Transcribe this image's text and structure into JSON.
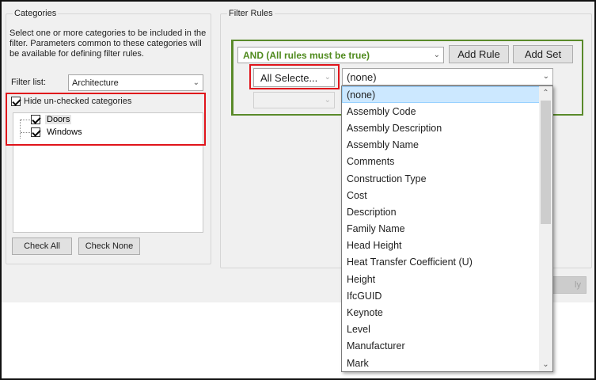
{
  "categories": {
    "title": "Categories",
    "description": "Select one or more categories to be included in the filter.  Parameters common to these categories will be available for defining filter rules.",
    "filter_list_label": "Filter list:",
    "filter_list_value": "Architecture",
    "hide_unchecked_label": "Hide un-checked categories",
    "hide_unchecked_checked": true,
    "tree_items": [
      {
        "label": "Doors",
        "checked": true
      },
      {
        "label": "Windows",
        "checked": true
      }
    ],
    "check_all_label": "Check All",
    "check_none_label": "Check None"
  },
  "filter_rules": {
    "title": "Filter Rules",
    "logic_value": "AND (All rules must be true)",
    "add_rule_label": "Add Rule",
    "add_set_label": "Add Set",
    "category_combo_value": "All Selecte...",
    "parameter_combo_value": "(none)",
    "disabled_button_label": "ly"
  },
  "parameter_dropdown": {
    "selected": "(none)",
    "options": [
      "(none)",
      "Assembly Code",
      "Assembly Description",
      "Assembly Name",
      "Comments",
      "Construction Type",
      "Cost",
      "Description",
      "Family Name",
      "Head Height",
      "Heat Transfer Coefficient (U)",
      "Height",
      "IfcGUID",
      "Keynote",
      "Level",
      "Manufacturer",
      "Mark"
    ]
  },
  "icons": {
    "chevron": "chevron-down-icon",
    "scroll_up": "scroll-up-icon",
    "scroll_down": "scroll-down-icon"
  },
  "colors": {
    "highlight_red": "#e0141b",
    "rules_green": "#4f8a1d",
    "selection_blue": "#cce8ff"
  }
}
